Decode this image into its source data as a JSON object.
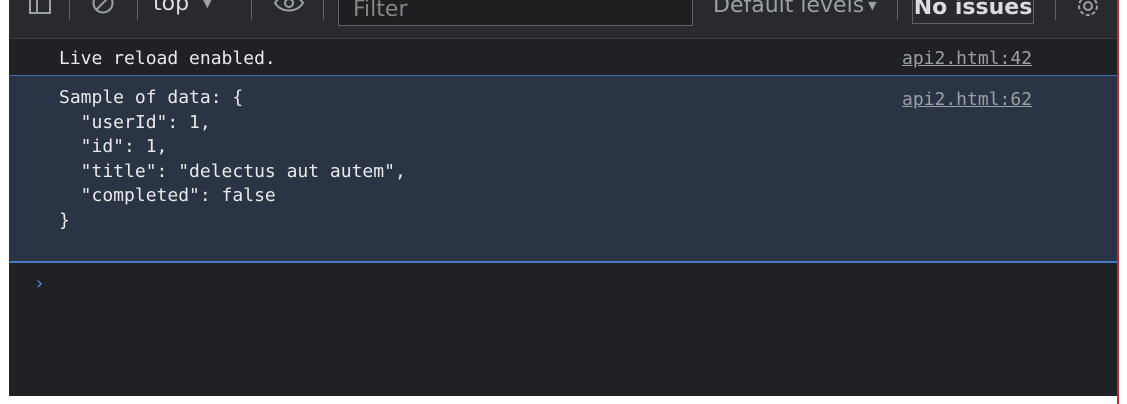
{
  "toolbar": {
    "context": "top",
    "filter_placeholder": "Filter",
    "levels_label": "Default levels",
    "issues_label": "No issues"
  },
  "console": {
    "messages": [
      {
        "text": "Live reload enabled.",
        "source": "api2.html:42"
      },
      {
        "text": "Sample of data: {\n  \"userId\": 1,\n  \"id\": 1,\n  \"title\": \"delectus aut autem\",\n  \"completed\": false\n}",
        "source": "api2.html:62"
      }
    ],
    "prompt_symbol": "›"
  },
  "colors": {
    "panel_bg": "#202124",
    "selected_row_bg": "#2a3444",
    "selected_row_border": "#4a78c6",
    "prompt": "#4e88e6",
    "right_edge": "#c7262b"
  }
}
